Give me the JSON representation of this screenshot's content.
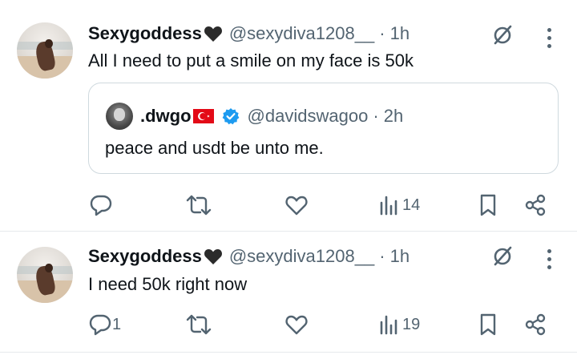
{
  "tweets": [
    {
      "name": "Sexygoddess",
      "handle": "@sexydiva1208__",
      "time": "· 1h",
      "text": "All I need to put a smile on my face is 50k",
      "actions": {
        "reply": "",
        "views": "14"
      },
      "quote": {
        "name": ".dwgo",
        "handle": "@davidswagoo",
        "time": "· 2h",
        "text": "peace and usdt be unto me."
      }
    },
    {
      "name": "Sexygoddess",
      "handle": "@sexydiva1208__",
      "time": "· 1h",
      "text": "I need 50k  right now",
      "actions": {
        "reply": "1",
        "views": "19"
      }
    }
  ],
  "colors": {
    "text": "#0f1419",
    "secondary": "#536471",
    "verified": "#1d9bf0",
    "flag": "#e30a17",
    "border": "#cfd9de"
  },
  "icons": [
    "black-heart-icon",
    "grok-icon",
    "more-icon",
    "reply-icon",
    "retweet-icon",
    "like-icon",
    "views-icon",
    "bookmark-icon",
    "share-icon",
    "verified-badge-icon",
    "turkey-flag-icon"
  ]
}
